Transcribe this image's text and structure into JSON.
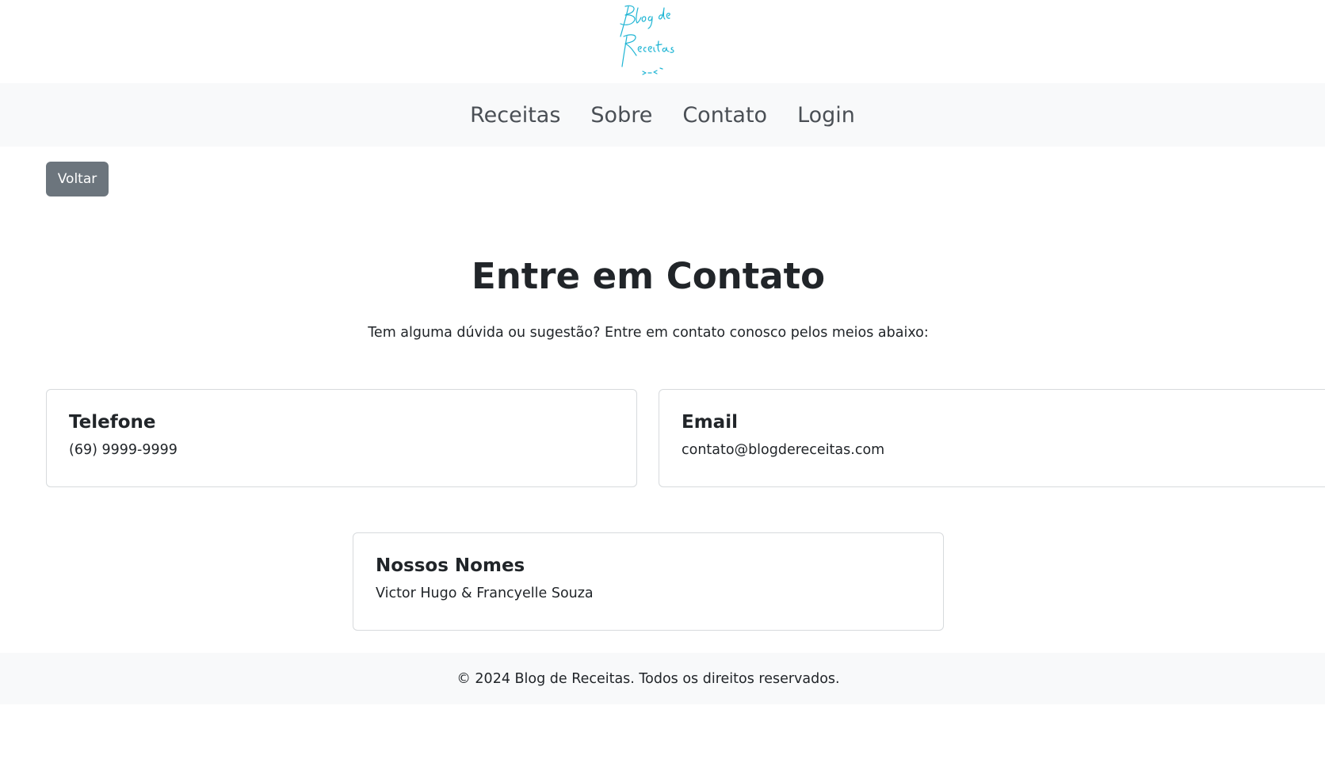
{
  "header": {
    "logo_text": "Blog de Receitas"
  },
  "nav": {
    "items": [
      {
        "label": "Receitas"
      },
      {
        "label": "Sobre"
      },
      {
        "label": "Contato"
      },
      {
        "label": "Login"
      }
    ]
  },
  "back_button": {
    "label": "Voltar"
  },
  "main": {
    "title": "Entre em Contato",
    "intro": "Tem alguma dúvida ou sugestão? Entre em contato conosco pelos meios abaixo:",
    "cards": [
      {
        "title": "Telefone",
        "text": "(69) 9999-9999"
      },
      {
        "title": "Email",
        "text": "contato@blogdereceitas.com"
      },
      {
        "title": "Nossos Nomes",
        "text": "Victor Hugo & Francyelle Souza"
      }
    ]
  },
  "footer": {
    "text": "© 2024 Blog de Receitas. Todos os direitos reservados."
  },
  "colors": {
    "logo": "#1fb5d4",
    "nav_bg": "#f8f9fa",
    "button_bg": "#6c757d",
    "text": "#212529"
  }
}
